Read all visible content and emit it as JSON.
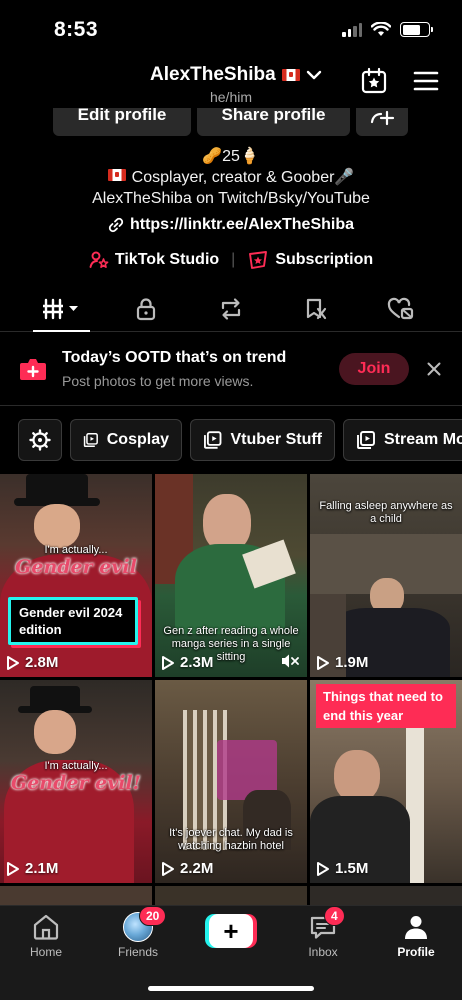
{
  "status_bar": {
    "time": "8:53"
  },
  "header": {
    "username": "AlexTheShiba",
    "pronouns": "he/him"
  },
  "profile_buttons": {
    "edit": "Edit profile",
    "share": "Share profile"
  },
  "bio": {
    "stats": "🥜25🍦",
    "line1": "Cosplayer, creator & Goober🎤",
    "line2": "AlexTheShiba on Twitch/Bsky/YouTube",
    "link": "https://linktr.ee/AlexTheShiba"
  },
  "quick_links": {
    "studio": "TikTok Studio",
    "subscription": "Subscription"
  },
  "tabs": [
    {
      "icon": "grid-videos-icon",
      "active": true
    },
    {
      "icon": "lock-icon"
    },
    {
      "icon": "repost-icon"
    },
    {
      "icon": "saved-icon"
    },
    {
      "icon": "liked-icon"
    }
  ],
  "banner": {
    "title": "Today’s OOTD that’s on trend",
    "subtitle": "Post photos to get more views.",
    "join": "Join"
  },
  "playlists": [
    "Cosplay",
    "Vtuber Stuff",
    "Stream Mo"
  ],
  "videos": [
    {
      "views": "2.8M",
      "caption_top": "I'm actually...",
      "caption_big": "Gender evil",
      "card": "Gender evil 2024 edition"
    },
    {
      "views": "2.3M",
      "caption": "Gen z after reading a whole manga series in a single sitting",
      "muted": true
    },
    {
      "views": "1.9M",
      "caption": "Falling asleep anywhere as a child"
    },
    {
      "views": "2.1M",
      "caption_top": "I'm actually...",
      "caption_big": "Gender evil!"
    },
    {
      "views": "2.2M",
      "caption": "It's joever chat. My dad is watching hazbin hotel"
    },
    {
      "views": "1.5M",
      "card": "Things that need to end this year"
    }
  ],
  "bottom_nav": {
    "home": "Home",
    "friends": "Friends",
    "friends_badge": "20",
    "inbox": "Inbox",
    "inbox_badge": "4",
    "profile": "Profile"
  },
  "colors": {
    "accent": "#fe2c55",
    "cyan": "#25f4ee",
    "background": "#000000"
  }
}
